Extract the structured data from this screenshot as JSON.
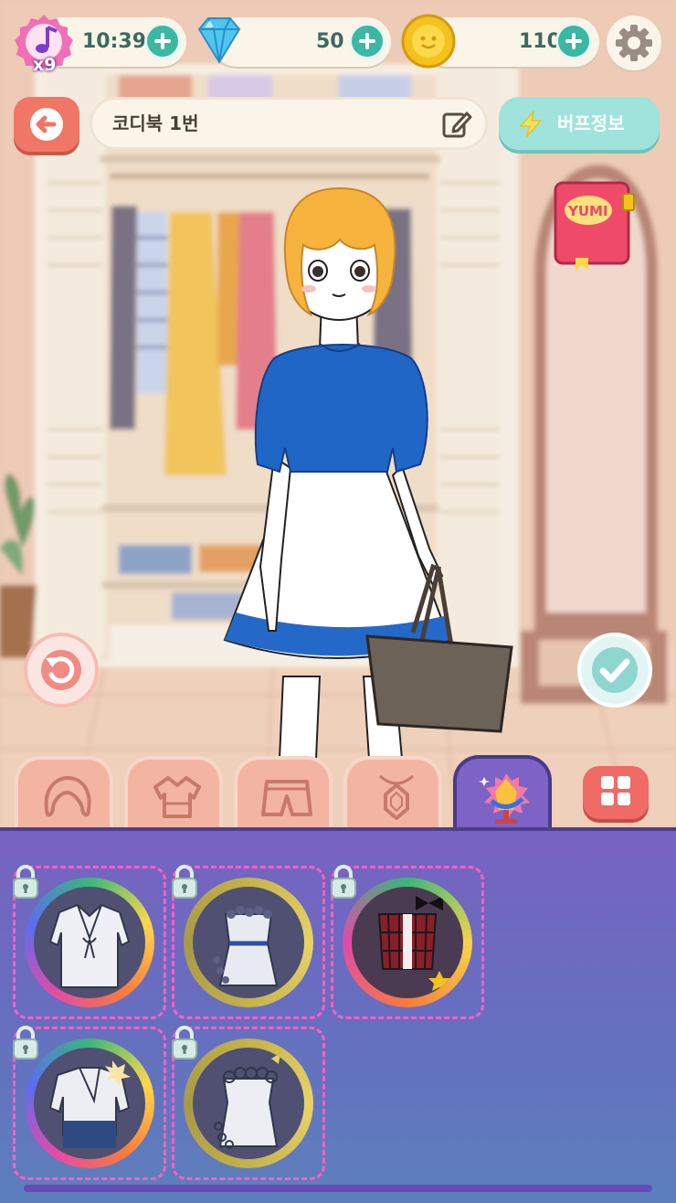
{
  "status_bar": {
    "energy": {
      "timer": "10:39",
      "multiplier": "x9",
      "icon": "music-note-badge-icon"
    },
    "gems": {
      "value": "50",
      "icon": "diamond-icon"
    },
    "coins": {
      "value": "110",
      "icon": "coin-icon"
    }
  },
  "header": {
    "outfit_name": "코디북 1번",
    "buff_label": "버프정보",
    "notebook_label": "YUMI"
  },
  "tabs": [
    {
      "name": "hair",
      "icon": "hair-icon",
      "active": false
    },
    {
      "name": "top",
      "icon": "blouse-icon",
      "active": false
    },
    {
      "name": "bottom",
      "icon": "shorts-icon",
      "active": false
    },
    {
      "name": "accessory",
      "icon": "pendant-icon",
      "active": false
    },
    {
      "name": "special",
      "icon": "mannequin-rainbow-icon",
      "active": true
    }
  ],
  "items": [
    {
      "name": "sailor-collar-blouse",
      "locked": true
    },
    {
      "name": "flower-lace-dress",
      "locked": true
    },
    {
      "name": "red-plaid-corset-top",
      "locked": true
    },
    {
      "name": "hanbok-flower-top",
      "locked": true
    },
    {
      "name": "floral-wreath-top",
      "locked": true
    }
  ],
  "colors": {
    "accent_teal": "#3bb7a4",
    "back_button": "#f07665",
    "panel_purple": "#7763c0",
    "top_blue": "#1f66c6"
  }
}
